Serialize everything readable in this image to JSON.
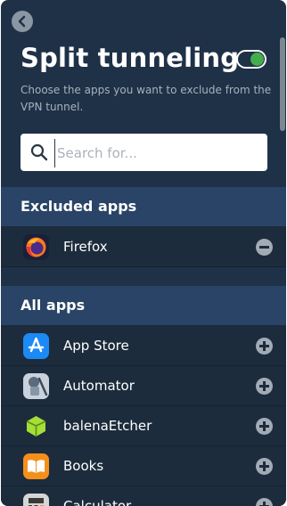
{
  "header": {
    "title": "Split tunneling",
    "toggle_on": true,
    "description": "Choose the apps you want to exclude from the VPN tunnel."
  },
  "search": {
    "placeholder": "Search for...",
    "value": ""
  },
  "excluded": {
    "title": "Excluded apps",
    "apps": [
      {
        "name": "Firefox",
        "icon": "firefox-icon",
        "action": "remove"
      }
    ]
  },
  "all_apps": {
    "title": "All apps",
    "apps": [
      {
        "name": "App Store",
        "icon": "app-store-icon",
        "action": "add"
      },
      {
        "name": "Automator",
        "icon": "automator-icon",
        "action": "add"
      },
      {
        "name": "balenaEtcher",
        "icon": "balena-etcher-icon",
        "action": "add"
      },
      {
        "name": "Books",
        "icon": "books-icon",
        "action": "add"
      },
      {
        "name": "Calculator",
        "icon": "calculator-icon",
        "action": "add"
      }
    ]
  },
  "colors": {
    "background": "#1f3147",
    "section_header": "#294466",
    "toggle_on": "#44ad4d"
  }
}
